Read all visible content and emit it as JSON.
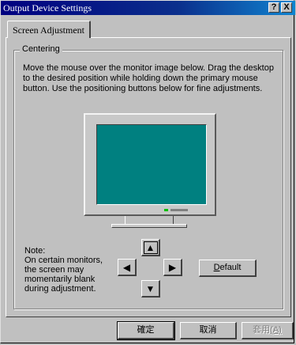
{
  "window": {
    "title": "Output Device Settings",
    "help_button": "?",
    "close_button": "X"
  },
  "tabs": [
    {
      "label": "Screen Adjustment",
      "selected": true
    }
  ],
  "centering": {
    "group_label": "Centering",
    "description": "Move the mouse over the monitor image below. Drag the desktop to the desired position while holding down the primary mouse button. Use the positioning buttons below for fine adjustments.",
    "note_lines": [
      "Note:",
      "On certain monitors,",
      "the screen may",
      "momentarily blank",
      "during adjustment."
    ],
    "arrows": {
      "up": "▲",
      "left": "◀",
      "right": "▶",
      "down": "▼"
    },
    "default_button": {
      "accel": "D",
      "rest": "efault"
    }
  },
  "monitor": {
    "screen_color": "#008080"
  },
  "footer": {
    "ok_label": "確定",
    "cancel_label": "取消",
    "apply_label": "套用",
    "apply_accel": "(A)"
  },
  "colors": {
    "face": "#c0c0c0",
    "titlebar": "#000080",
    "screen": "#008080"
  }
}
